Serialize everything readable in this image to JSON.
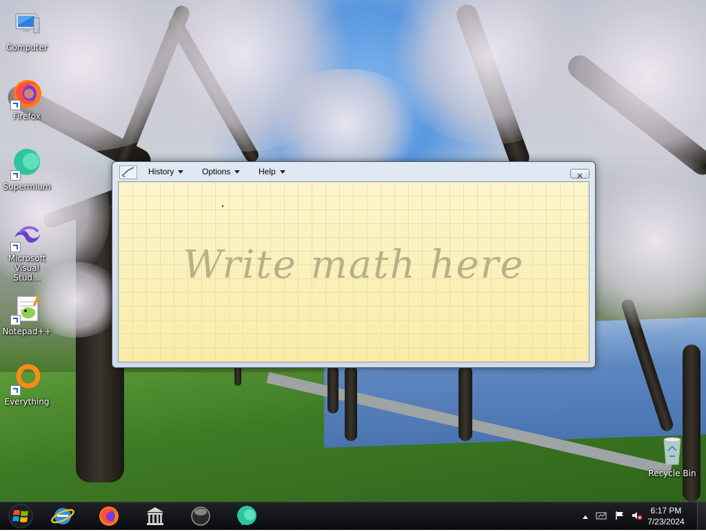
{
  "desktop": {
    "icons": [
      {
        "label": "Computer",
        "icon": "computer-icon"
      },
      {
        "label": "Firefox",
        "icon": "firefox-icon"
      },
      {
        "label": "Supermium",
        "icon": "supermium-icon"
      },
      {
        "label": "Microsoft Visual Stud...",
        "icon": "visual-studio-icon"
      },
      {
        "label": "Notepad++",
        "icon": "notepad-plus-plus-icon"
      },
      {
        "label": "Everything",
        "icon": "everything-search-icon"
      },
      {
        "label": "Recycle Bin",
        "icon": "recycle-bin-icon"
      }
    ]
  },
  "math_input_panel": {
    "menu": {
      "history": "History",
      "options": "Options",
      "help": "Help"
    },
    "writing_area_hint": "Write math here"
  },
  "taskbar": {
    "start_icon": "windows-start-icon",
    "apps": [
      {
        "icon": "internet-explorer-icon"
      },
      {
        "icon": "firefox-icon"
      },
      {
        "icon": "library-icon"
      },
      {
        "icon": "orb-app-icon"
      },
      {
        "icon": "supermium-icon"
      }
    ],
    "tray": {
      "icons": [
        "show-hidden-icons-chevron",
        "network-icon",
        "action-center-flag-icon",
        "volume-muted-icon"
      ]
    },
    "clock": {
      "time": "6:17 PM",
      "date": "7/23/2024"
    }
  },
  "colors": {
    "writing_area": "#fbf0b8",
    "hint_text": "#b7b08a",
    "taskbar": "#0b0c0e",
    "window_frame": "#cfdbea"
  }
}
